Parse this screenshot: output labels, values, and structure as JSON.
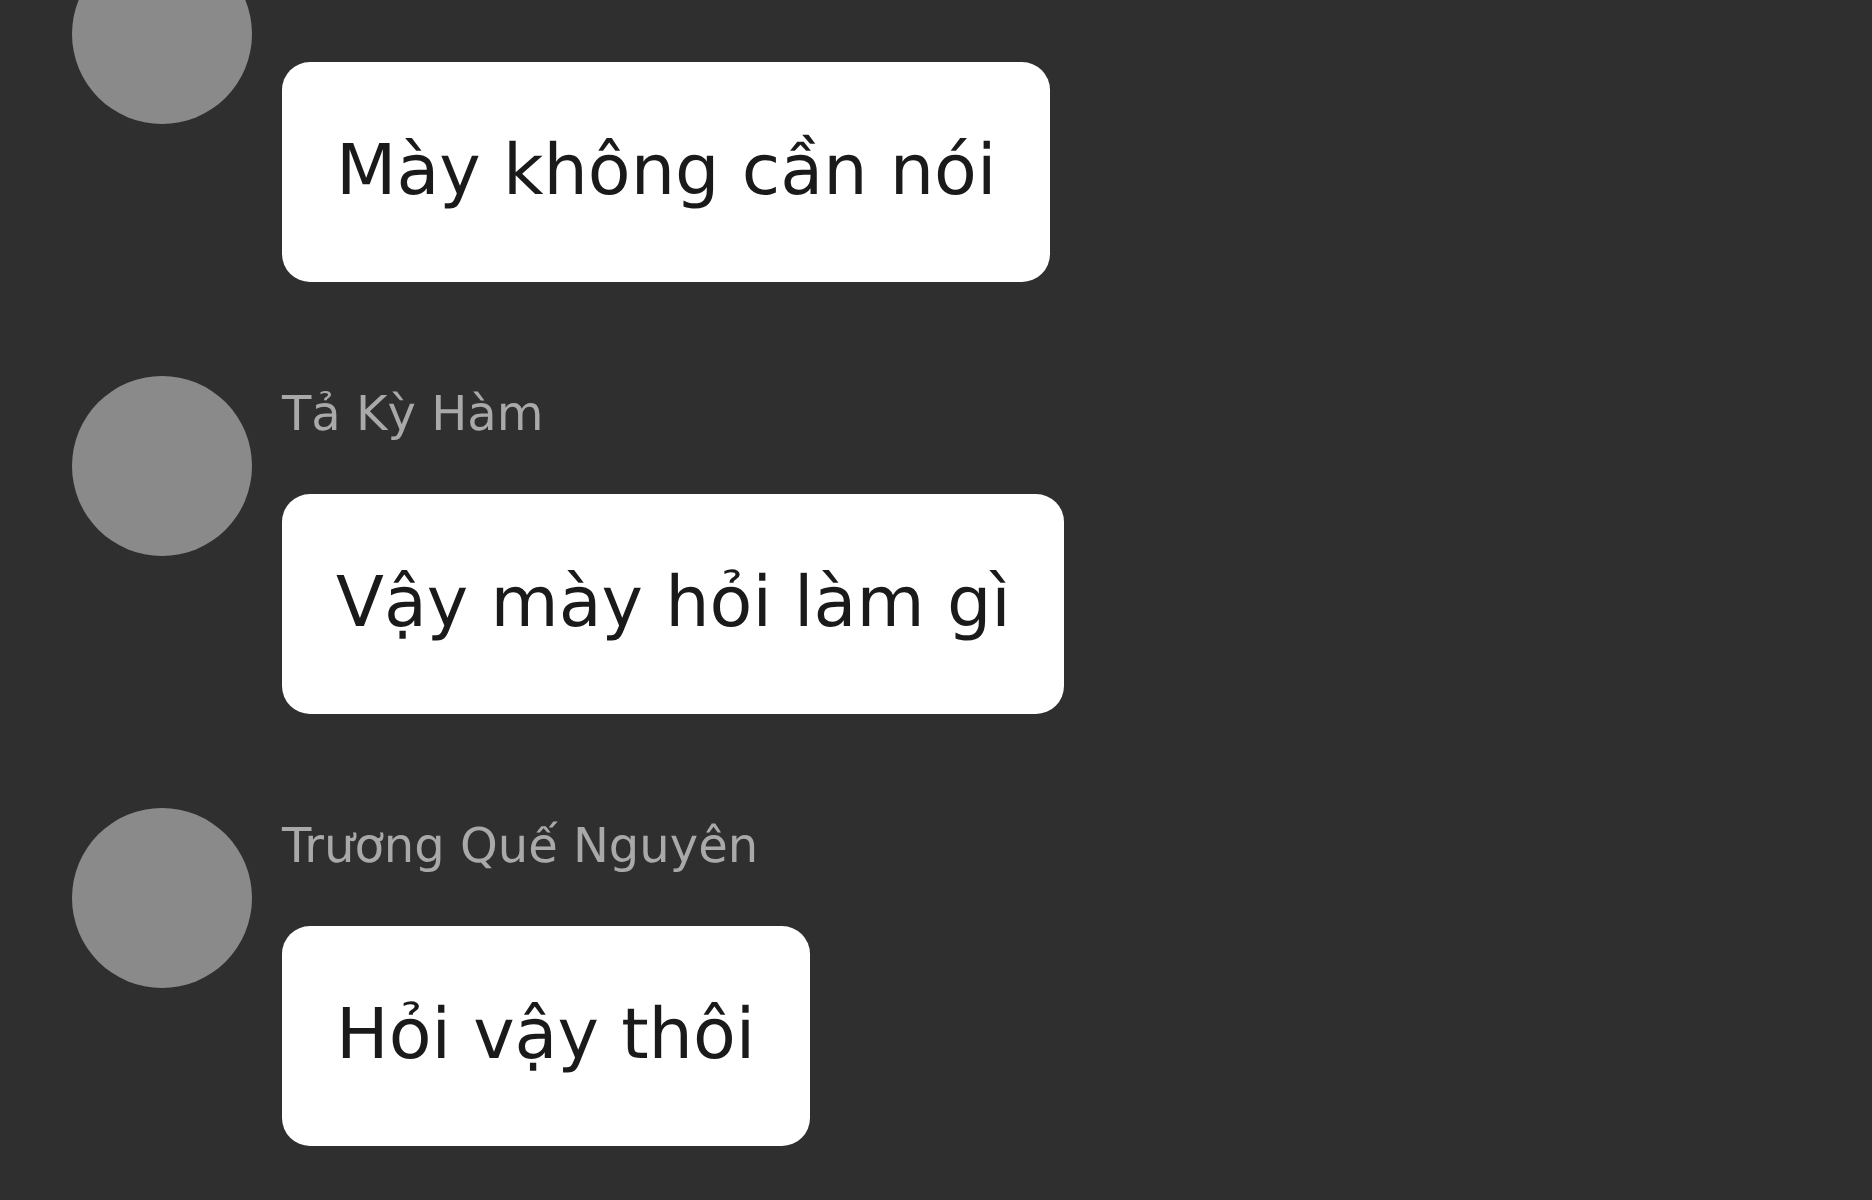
{
  "messages": [
    {
      "text": "Mày không cần nói"
    },
    {
      "sender": "Tả Kỳ Hàm",
      "text": "Vậy mày hỏi làm gì"
    },
    {
      "sender": "Trương Quế Nguyên",
      "text": "Hỏi vậy thôi"
    }
  ]
}
